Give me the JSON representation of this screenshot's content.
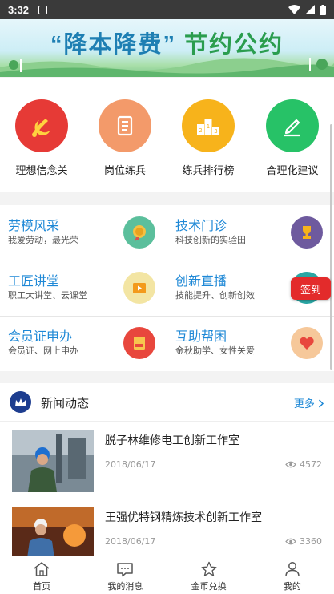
{
  "status_bar": {
    "time": "3:32"
  },
  "banner": {
    "quote_open": "“",
    "part1": "降本降费",
    "quote_close": "”",
    "part2": "节约公约"
  },
  "quick_menu": [
    {
      "label": "理想信念关",
      "icon": "party-emblem-icon",
      "color": "#e63a36"
    },
    {
      "label": "岗位练兵",
      "icon": "scroll-icon",
      "color": "#f39a6a"
    },
    {
      "label": "练兵排行榜",
      "icon": "podium-icon",
      "color": "#f7b31b"
    },
    {
      "label": "合理化建议",
      "icon": "edit-icon",
      "color": "#27c267"
    }
  ],
  "services": [
    {
      "title": "劳模风采",
      "subtitle": "我爱劳动，最光荣",
      "icon": "medal-icon",
      "icon_bg": "#5bbf9c"
    },
    {
      "title": "技术门诊",
      "subtitle": "科技创新的实验田",
      "icon": "trophy-icon",
      "icon_bg": "#6e5a9e"
    },
    {
      "title": "工匠讲堂",
      "subtitle": "职工大讲堂、云课堂",
      "icon": "video-icon",
      "icon_bg": "#f3e5a3"
    },
    {
      "title": "创新直播",
      "subtitle": "技能提升、创新创效",
      "icon": "live-icon",
      "icon_bg": "#2aa6a4"
    },
    {
      "title": "会员证申办",
      "subtitle": "会员证、网上申办",
      "icon": "vip-card-icon",
      "icon_bg": "#e8473d"
    },
    {
      "title": "互助帮困",
      "subtitle": "金秋助学、女性关爱",
      "icon": "heart-hands-icon",
      "icon_bg": "#f6c89a"
    }
  ],
  "signin_button": "签到",
  "news": {
    "heading": "新闻动态",
    "more": "更多",
    "items": [
      {
        "title": "脱子林维修电工创新工作室",
        "date": "2018/06/17",
        "views": "4572"
      },
      {
        "title": "王强优特钢精炼技术创新工作室",
        "date": "2018/06/17",
        "views": "3360"
      }
    ]
  },
  "tab_bar": [
    {
      "label": "首页",
      "icon": "home-icon"
    },
    {
      "label": "我的消息",
      "icon": "message-icon"
    },
    {
      "label": "金币兑换",
      "icon": "star-icon"
    },
    {
      "label": "我的",
      "icon": "user-icon"
    }
  ]
}
